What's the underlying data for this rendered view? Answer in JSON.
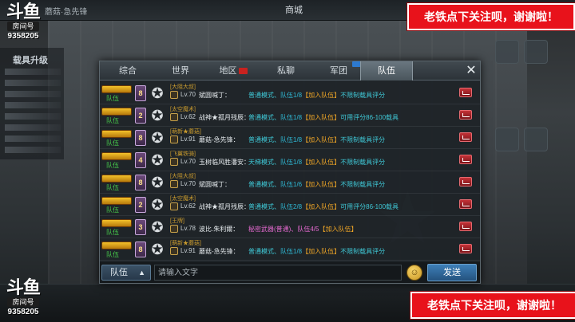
{
  "scene": {
    "title": "蘑菇·急先锋",
    "store_label": "商城",
    "left_panel_title": "载具升级"
  },
  "overlay": {
    "logo_mark": "斗鱼",
    "logo_room_label": "房间号",
    "logo_room_number": "9358205",
    "banner_text": "老铁点下关注呗，谢谢啦！"
  },
  "tabs": [
    {
      "label": "综合"
    },
    {
      "label": "世界"
    },
    {
      "label": "地区"
    },
    {
      "label": "私聊"
    },
    {
      "label": "军团"
    },
    {
      "label": "队伍"
    }
  ],
  "active_tab": "队伍",
  "messages": [
    {
      "channel": "队伍",
      "vip": "8",
      "guild": "[大阻大叔]",
      "level": "Lv.70",
      "sender": "斌圆喊丁：",
      "mode": "普通模式、",
      "team": "队伍1/8",
      "join": "【加入队伍】",
      "requirement": "不限制载具评分",
      "pink": false
    },
    {
      "channel": "队伍",
      "vip": "2",
      "guild": "[太空魔术]",
      "level": "Lv.62",
      "sender": "战神★孤月残辰：",
      "mode": "普通模式、",
      "team": "队伍1/8",
      "join": "【加入队伍】",
      "requirement": "可用评分86-100载具",
      "pink": false
    },
    {
      "channel": "队伍",
      "vip": "8",
      "guild": "[萌新★蘑菇]",
      "level": "Lv.91",
      "sender": "蘑菇-急先锋：",
      "mode": "普通模式、",
      "team": "队伍1/8",
      "join": "【加入队伍】",
      "requirement": "不限制载具评分",
      "pink": false
    },
    {
      "channel": "队伍",
      "vip": "4",
      "guild": "[飞翼铁骑]",
      "level": "Lv.70",
      "sender": "玉树临风胜潘安：",
      "mode": "天梯模式、",
      "team": "队伍1/8",
      "join": "【加入队伍】",
      "requirement": "不限制载具评分",
      "pink": false
    },
    {
      "channel": "队伍",
      "vip": "8",
      "guild": "[大阻大叔]",
      "level": "Lv.70",
      "sender": "斌圆喊丁：",
      "mode": "普通模式、",
      "team": "队伍1/6",
      "join": "【加入队伍】",
      "requirement": "不限制载具评分",
      "pink": false
    },
    {
      "channel": "队伍",
      "vip": "2",
      "guild": "[太空魔术]",
      "level": "Lv.62",
      "sender": "战神★孤月残辰：",
      "mode": "普通模式、",
      "team": "队伍2/8",
      "join": "【加入队伍】",
      "requirement": "可用评分86-100载具",
      "pink": false
    },
    {
      "channel": "队伍",
      "vip": "3",
      "guild": "[王牌]",
      "level": "Lv.78",
      "sender": "波比.朱利爾：",
      "mode": "秘密武器(普通)、",
      "team": "队伍4/5",
      "join": "【加入队伍】",
      "requirement": "",
      "pink": true
    },
    {
      "channel": "队伍",
      "vip": "8",
      "guild": "[萌新★蘑菇]",
      "level": "Lv.91",
      "sender": "蘑菇-急先锋：",
      "mode": "普通模式、",
      "team": "队伍1/8",
      "join": "【加入队伍】",
      "requirement": "不限制载具评分",
      "pink": false
    }
  ],
  "input": {
    "channel_label": "队伍",
    "placeholder": "请输入文字",
    "send_label": "发送"
  },
  "colors": {
    "banner": "#e8121b",
    "join": "#f0a626",
    "mode": "#3fc8d6",
    "mode_pink": "#e56ad0",
    "team_channel": "#46c74a"
  }
}
